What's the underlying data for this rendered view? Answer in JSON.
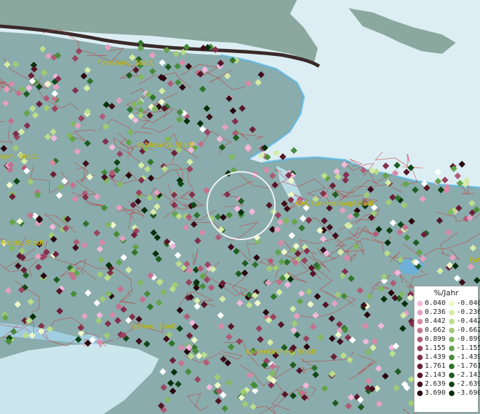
{
  "map": {
    "cities": [
      {
        "id": "flensburg",
        "label": "Flensburg, Stadt"
      },
      {
        "id": "schleswig",
        "label": "Schleswig, Stadt"
      },
      {
        "id": "husum",
        "label": "sum, Stadt"
      },
      {
        "id": "kiel",
        "label": "Kiel, Landeshauptstadt"
      },
      {
        "id": "heide",
        "label": "Heide, Stadt"
      },
      {
        "id": "eutin",
        "label": "Eut"
      },
      {
        "id": "itzehoe",
        "label": "Itzehoe, Stadt"
      },
      {
        "id": "kaltenkirchen",
        "label": "Kaltenkirchen, Stadt"
      }
    ],
    "selection_circle": "selected-area-ring"
  },
  "legend": {
    "title": "%/Jahr",
    "positive": [
      {
        "label": "0.040",
        "color": "#f2b8dc"
      },
      {
        "label": "0.236",
        "color": "#e6a0c2"
      },
      {
        "label": "0.442",
        "color": "#d88aa8"
      },
      {
        "label": "0.662",
        "color": "#c4728e"
      },
      {
        "label": "0.899",
        "color": "#b05c76"
      },
      {
        "label": "1.155",
        "color": "#9a4460"
      },
      {
        "label": "1.439",
        "color": "#84304c"
      },
      {
        "label": "1.761",
        "color": "#6c2038"
      },
      {
        "label": "2.143",
        "color": "#561628"
      },
      {
        "label": "2.639",
        "color": "#400e1a"
      },
      {
        "label": "3.690",
        "color": "#2a060e"
      }
    ],
    "negative": [
      {
        "label": "-0.040",
        "color": "#eef7c8"
      },
      {
        "label": "-0.236",
        "color": "#d6eca6"
      },
      {
        "label": "-0.442",
        "color": "#bcdd8c"
      },
      {
        "label": "-0.662",
        "color": "#a0cc76"
      },
      {
        "label": "-0.899",
        "color": "#82b860"
      },
      {
        "label": "-1.155",
        "color": "#64a44c"
      },
      {
        "label": "-1.439",
        "color": "#488c3a"
      },
      {
        "label": "-1.761",
        "color": "#30742c"
      },
      {
        "label": "-2.143",
        "color": "#1e5c20"
      },
      {
        "label": "-2.639",
        "color": "#104616"
      },
      {
        "label": "-3.690",
        "color": "#06300c"
      }
    ]
  }
}
